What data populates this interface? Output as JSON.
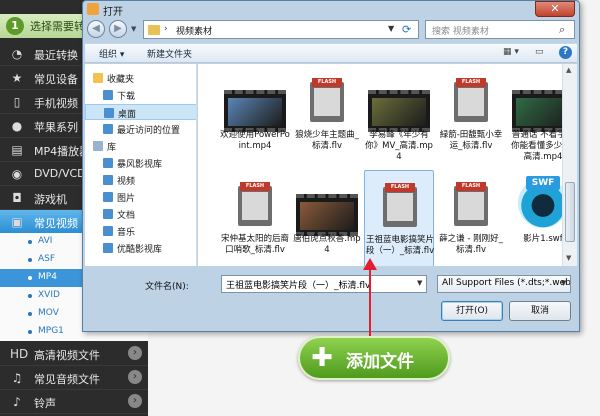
{
  "app": {
    "step": {
      "number": "1",
      "text": "选择需要转换的文件"
    },
    "categories_top": [
      {
        "label": "最近转换",
        "icon": "clock-icon"
      },
      {
        "label": "常见设备",
        "icon": "star-icon"
      },
      {
        "label": "手机视频",
        "icon": "phone-icon"
      },
      {
        "label": "苹果系列",
        "icon": "apple-icon"
      },
      {
        "label": "MP4播放器",
        "icon": "player-icon"
      },
      {
        "label": "DVD/VCD",
        "icon": "disc-icon"
      },
      {
        "label": "游戏机",
        "icon": "gamepad-icon"
      },
      {
        "label": "常见视频",
        "icon": "video-icon"
      }
    ],
    "formats": [
      "AVI",
      "ASF",
      "MP4",
      "XVID",
      "MOV",
      "MPG1"
    ],
    "selected_format": "MP4",
    "categories_bottom": [
      {
        "label": "高清视频文件",
        "icon": "hd-icon"
      },
      {
        "label": "常见音频文件",
        "icon": "music-icon"
      },
      {
        "label": "铃声",
        "icon": "bell-icon"
      }
    ],
    "add_file_label": "添加文件"
  },
  "dialog": {
    "title": "打开",
    "close_label": "✕",
    "breadcrumb": "视频素材",
    "search_placeholder": "搜索 视频素材",
    "toolbar": {
      "organize": "组织 ▾",
      "new_folder": "新建文件夹"
    },
    "nav": [
      {
        "label": "收藏夹",
        "level": 0
      },
      {
        "label": "下载",
        "level": 1
      },
      {
        "label": "桌面",
        "level": 1,
        "active": true
      },
      {
        "label": "最近访问的位置",
        "level": 1
      },
      {
        "label": "库",
        "level": 0
      },
      {
        "label": "暴风影视库",
        "level": 1
      },
      {
        "label": "视频",
        "level": 1
      },
      {
        "label": "图片",
        "level": 1
      },
      {
        "label": "文档",
        "level": 1
      },
      {
        "label": "音乐",
        "level": 1
      },
      {
        "label": "优酷影视库",
        "level": 1
      }
    ],
    "files": [
      {
        "name": "欢迎使用PowerPoint.mp4",
        "kind": "video",
        "tint": "#5a86b5"
      },
      {
        "name": "狼烧少年主题曲_标清.flv",
        "kind": "flash"
      },
      {
        "name": "李易峰《年少有你》MV_高清.mp4",
        "kind": "video",
        "tint": "#6b6e3a"
      },
      {
        "name": "緑箭-田馥甄小幸运_标清.flv",
        "kind": "flash"
      },
      {
        "name": "普通话 不看字幕你能看懂多少？_高清.mp4",
        "kind": "video",
        "tint": "#2f6b45"
      },
      {
        "name": "宋仲基太阳的后裔口哨歌_标清.flv",
        "kind": "flash"
      },
      {
        "name": "唐伯虎点秋香.mp4",
        "kind": "video",
        "tint": "#8a5a3a"
      },
      {
        "name": "王祖蓝电影搞笑片段（一）_标清.flv",
        "kind": "flash",
        "selected": true
      },
      {
        "name": "薛之谦 - 刚刚好_标清.flv",
        "kind": "flash"
      },
      {
        "name": "影片1.swf",
        "kind": "swf"
      }
    ],
    "swf_tag": "SWF",
    "flash_tag": "FLASH",
    "filename_label": "文件名(N):",
    "filename_value": "王祖蓝电影搞笑片段（一）_标清.flv",
    "filetype_value": "All Support Files (*.dts;*.web",
    "open_button": "打开(O)",
    "cancel_button": "取消"
  }
}
